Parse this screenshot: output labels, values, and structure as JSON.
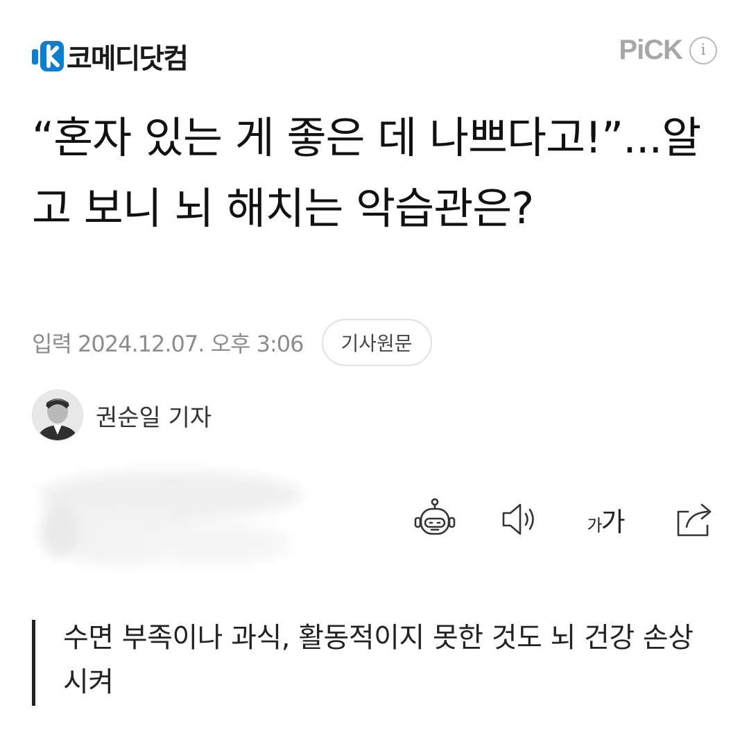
{
  "header": {
    "logo_text": "코메디닷컴",
    "pick_label": "PiCK",
    "info_glyph": "i",
    "brand_color": "#0a7fd1"
  },
  "article": {
    "title": "“혼자 있는 게 좋은 데 나쁘다고!”...알고 보니 뇌 해치는 악습관은?",
    "date": "입력 2024.12.07. 오후 3:06",
    "original_button": "기사원문",
    "author": "권순일 기자",
    "summary": "수면 부족이나 과식, 활동적이지 못한 것도 뇌 건강 손상시켜"
  },
  "toolbar": {
    "items": [
      {
        "icon": "robot-summary-icon"
      },
      {
        "icon": "speaker-icon"
      },
      {
        "icon": "font-size-icon",
        "small": "가",
        "large": "가"
      },
      {
        "icon": "share-icon"
      }
    ]
  }
}
